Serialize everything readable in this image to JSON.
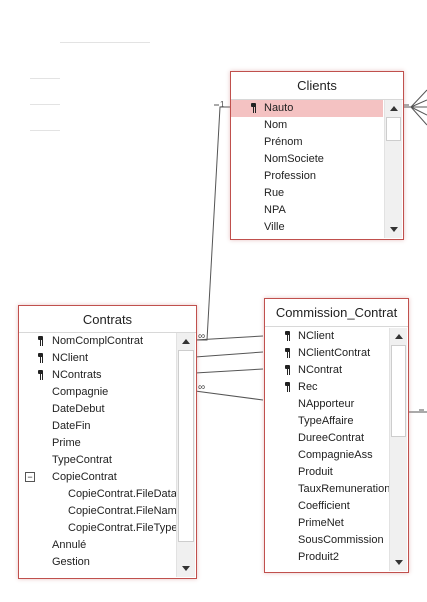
{
  "tables": {
    "clients": {
      "title": "Clients",
      "fields": [
        "Nauto",
        "Nom",
        "Prénom",
        "NomSociete",
        "Profession",
        "Rue",
        "NPA",
        "Ville"
      ]
    },
    "contrats": {
      "title": "Contrats",
      "fields": [
        "NomComplContrat",
        "NClient",
        "NContrats",
        "Compagnie",
        "DateDebut",
        "DateFin",
        "Prime",
        "TypeContrat",
        "CopieContrat",
        "CopieContrat.FileData",
        "CopieContrat.FileName",
        "CopieContrat.FileType",
        "Annulé",
        "Gestion"
      ]
    },
    "commission": {
      "title": "Commission_Contrat",
      "fields": [
        "NClient",
        "NClientContrat",
        "NContrat",
        "Rec",
        "NApporteur",
        "TypeAffaire",
        "DureeContrat",
        "CompagnieAss",
        "Produit",
        "TauxRemuneration",
        "Coefficient",
        "PrimeNet",
        "SousCommission",
        "Produit2"
      ]
    }
  },
  "relationship_labels": {
    "one": "1",
    "many": "∞"
  },
  "expander_symbol": "−"
}
